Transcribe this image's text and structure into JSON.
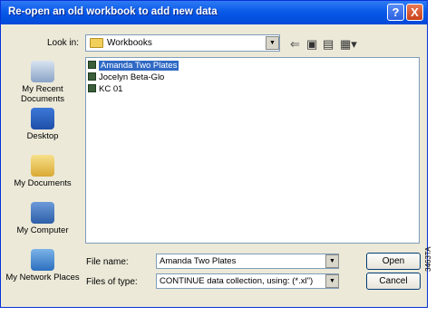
{
  "dialog": {
    "title": "Re-open an old workbook to add new data",
    "help_label": "?",
    "close_label": "X"
  },
  "lookin": {
    "label": "Look in:",
    "value": "Workbooks",
    "icon": "folder-icon"
  },
  "toolbar": {
    "back_icon": "back-arrow-icon",
    "up_icon": "up-folder-icon",
    "new_folder_icon": "new-folder-icon",
    "views_icon": "views-menu-icon"
  },
  "places": [
    {
      "label": "My Recent Documents",
      "icon": "recent-documents-icon"
    },
    {
      "label": "Desktop",
      "icon": "desktop-icon"
    },
    {
      "label": "My Documents",
      "icon": "my-documents-icon"
    },
    {
      "label": "My Computer",
      "icon": "my-computer-icon"
    },
    {
      "label": "My Network Places",
      "icon": "network-places-icon"
    }
  ],
  "files": [
    {
      "name": "Amanda Two Plates",
      "selected": true
    },
    {
      "name": "Jocelyn Beta-Glo",
      "selected": false
    },
    {
      "name": "KC 01",
      "selected": false
    }
  ],
  "filename": {
    "label": "File name:",
    "value": "Amanda Two Plates"
  },
  "filetype": {
    "label": "Files of type:",
    "value": "CONTINUE data collection, using: (*.xl\")"
  },
  "buttons": {
    "open": "Open",
    "cancel": "Cancel"
  },
  "side_code": "3463TA",
  "colors": {
    "title_bar": "#0a5ae8",
    "selection": "#316ac5",
    "dialog_bg": "#ece9d8"
  }
}
